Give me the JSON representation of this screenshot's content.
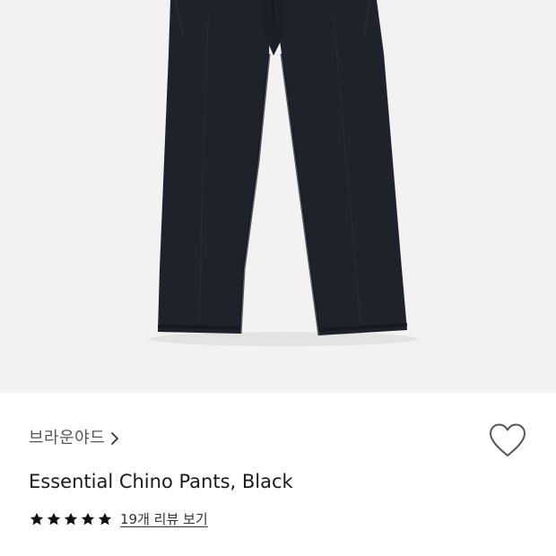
{
  "product": {
    "image_alt": "Essential Chino Pants, Black",
    "image_colors": {
      "background": "#f2f2f2",
      "fabric": "#1d222b",
      "fabric_shadow": "#141820"
    },
    "brand": "브라운야드",
    "title": "Essential Chino Pants, Black",
    "rating": 5,
    "rating_max": 5,
    "review_link": "19개 리뷰 보기"
  },
  "icons": {
    "brand_chevron": "chevron-right-icon",
    "wishlist": "heart-outline-icon",
    "star": "star-filled-icon"
  },
  "colors": {
    "star": "#111111",
    "heart_stroke": "#555555",
    "text_primary": "#1a1a1a",
    "text_secondary": "#555555"
  }
}
